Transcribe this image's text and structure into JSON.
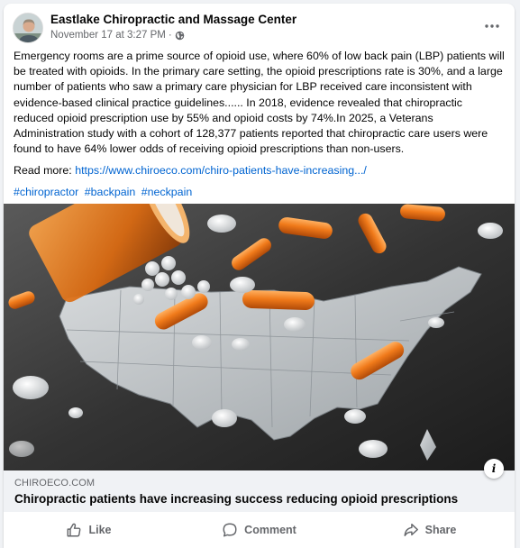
{
  "post": {
    "author": "Eastlake Chiropractic and Massage Center",
    "timestamp": "November 17 at 3:27 PM",
    "separator": "·",
    "audience_icon": "globe-icon",
    "menu_icon": "more-horizontal-icon",
    "body": "Emergency rooms are a prime source of opioid use, where 60% of low back pain (LBP) patients will be treated with opioids. In the primary care setting, the opioid prescriptions rate is 30%, and a large number of patients who saw a primary care physician for LBP received care inconsistent with evidence-based clinical practice guidelines...... In 2018, evidence revealed that chiropractic reduced opioid prescription use by 55% and opioid costs by 74%.In 2025, a Veterans Administration study with a cohort of 128,377 patients reported that chiropractic care users were found to have 64% lower odds of receiving opioid prescriptions than non-users.",
    "read_more_label": "Read more:",
    "read_more_link": "https://www.chiroeco.com/chiro-patients-have-increasing.../",
    "hashtags": [
      "#chiropractor",
      "#backpain",
      "#neckpain"
    ]
  },
  "link_preview": {
    "domain": "CHIROECO.COM",
    "title": "Chiropractic patients have increasing success reducing opioid prescriptions",
    "info_label": "i"
  },
  "actions": {
    "like": "Like",
    "comment": "Comment",
    "share": "Share"
  },
  "colors": {
    "link": "#0064d1",
    "secondary_text": "#65676b",
    "card_background": "#f0f2f5",
    "pill_orange": "#f07a1a"
  }
}
